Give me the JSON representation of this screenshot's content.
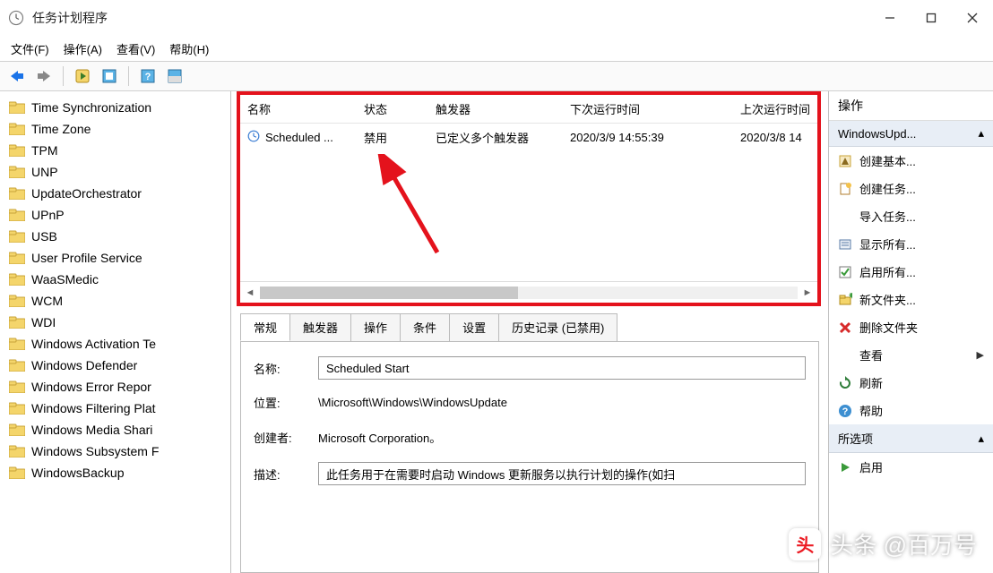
{
  "window": {
    "title": "任务计划程序"
  },
  "menubar": [
    "文件(F)",
    "操作(A)",
    "查看(V)",
    "帮助(H)"
  ],
  "sidebar": {
    "items": [
      "Time Synchronization",
      "Time Zone",
      "TPM",
      "UNP",
      "UpdateOrchestrator",
      "UPnP",
      "USB",
      "User Profile Service",
      "WaaSMedic",
      "WCM",
      "WDI",
      "Windows Activation Te",
      "Windows Defender",
      "Windows Error Repor",
      "Windows Filtering Plat",
      "Windows Media Shari",
      "Windows Subsystem F",
      "WindowsBackup"
    ]
  },
  "tasklist": {
    "columns": {
      "name": "名称",
      "status": "状态",
      "trigger": "触发器",
      "next": "下次运行时间",
      "last": "上次运行时间"
    },
    "rows": [
      {
        "name": "Scheduled ...",
        "status": "禁用",
        "trigger": "已定义多个触发器",
        "next": "2020/3/9 14:55:39",
        "last": "2020/3/8 14"
      }
    ]
  },
  "detail": {
    "tabs": [
      "常规",
      "触发器",
      "操作",
      "条件",
      "设置",
      "历史记录 (已禁用)"
    ],
    "fields": {
      "name_label": "名称:",
      "name_value": "Scheduled Start",
      "location_label": "位置:",
      "location_value": "\\Microsoft\\Windows\\WindowsUpdate",
      "creator_label": "创建者:",
      "creator_value": "Microsoft Corporation。",
      "desc_label": "描述:",
      "desc_value": "此任务用于在需要时启动 Windows 更新服务以执行计划的操作(如扫"
    }
  },
  "actions": {
    "header": "操作",
    "group1": {
      "title": "WindowsUpd...",
      "items": [
        {
          "icon": "wizard-icon",
          "label": "创建基本..."
        },
        {
          "icon": "new-task-icon",
          "label": "创建任务..."
        },
        {
          "icon": "none",
          "label": "导入任务..."
        },
        {
          "icon": "list-icon",
          "label": "显示所有..."
        },
        {
          "icon": "enable-all-icon",
          "label": "启用所有..."
        },
        {
          "icon": "new-folder-icon",
          "label": "新文件夹..."
        },
        {
          "icon": "delete-icon",
          "label": "删除文件夹"
        },
        {
          "icon": "none",
          "label": "查看",
          "caret": true
        },
        {
          "icon": "refresh-icon",
          "label": "刷新"
        },
        {
          "icon": "help-icon",
          "label": "帮助"
        }
      ]
    },
    "group2": {
      "title": "所选项",
      "items": [
        {
          "icon": "enable-icon",
          "label": "启用"
        }
      ]
    }
  },
  "watermark": {
    "text": "头条 @百万号"
  }
}
